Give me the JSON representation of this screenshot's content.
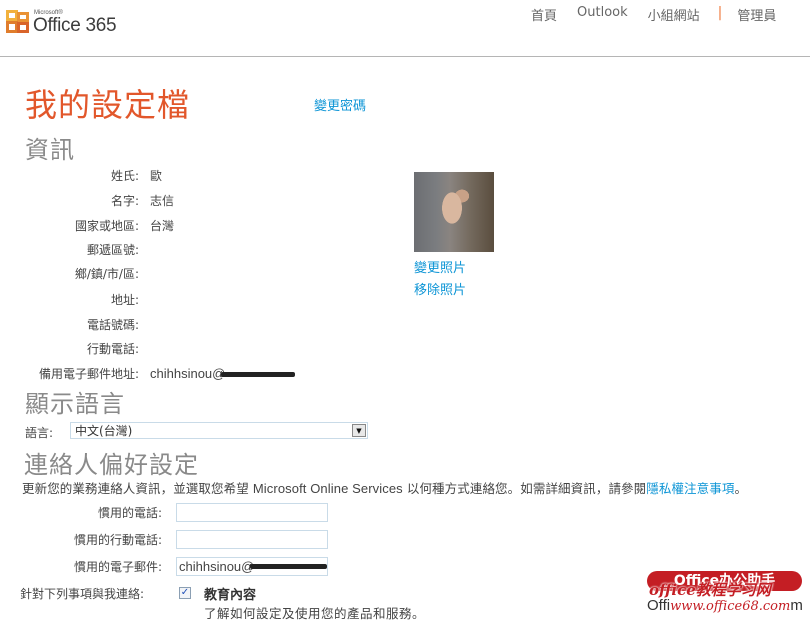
{
  "header": {
    "logo_small": "Microsoft®",
    "logo_name": "Office 365",
    "nav": [
      "首頁",
      "Outlook",
      "小組網站"
    ],
    "nav_separator": "|",
    "admin": "管理員",
    "accent_color": "#f07b3f"
  },
  "page": {
    "title": "我的設定檔",
    "change_password": "變更密碼",
    "title_color": "#e2572b",
    "link_color": "#0d95d6"
  },
  "info": {
    "heading": "資訊",
    "fields": [
      {
        "label": "姓氏:",
        "value": "歐"
      },
      {
        "label": "名字:",
        "value": "志信"
      },
      {
        "label": "國家或地區:",
        "value": "台灣"
      },
      {
        "label": "郵遞區號:",
        "value": ""
      },
      {
        "label": "鄉/鎮/市/區:",
        "value": ""
      },
      {
        "label": "地址:",
        "value": ""
      },
      {
        "label": "電話號碼:",
        "value": ""
      },
      {
        "label": "行動電話:",
        "value": ""
      },
      {
        "label": "備用電子郵件地址:",
        "value": "chihhsinou@"
      }
    ],
    "photo_alt": "dog photo",
    "change_photo": "變更照片",
    "remove_photo": "移除照片"
  },
  "language": {
    "heading": "顯示語言",
    "label": "語言:",
    "selected": "中文(台灣)"
  },
  "contact": {
    "heading": "連絡人偏好設定",
    "desc_before": "更新您的業務連絡人資訊，並選取您希望 ",
    "desc_en": "Microsoft Online Services",
    "desc_after": " 以何種方式連絡您。如需詳細資訊，請參閱",
    "privacy_link": "隱私權注意事項",
    "desc_end": "。",
    "fields": [
      {
        "label": "慣用的電話:",
        "value": ""
      },
      {
        "label": "慣用的行動電話:",
        "value": ""
      },
      {
        "label": "慣用的電子郵件:",
        "value": "chihhsinou@"
      }
    ],
    "contact_me_label": "針對下列事項與我連絡:",
    "checkbox_checked": true,
    "checkbox_mark": "✓",
    "edu_title": "教育內容",
    "edu_desc": "了解如何設定及使用您的產品和服務。"
  },
  "watermark": {
    "bar": "Office办公助手",
    "overlay": "office教程学习网",
    "url": "www.office68.com",
    "prefix": "Offi",
    "suffix": "m"
  }
}
